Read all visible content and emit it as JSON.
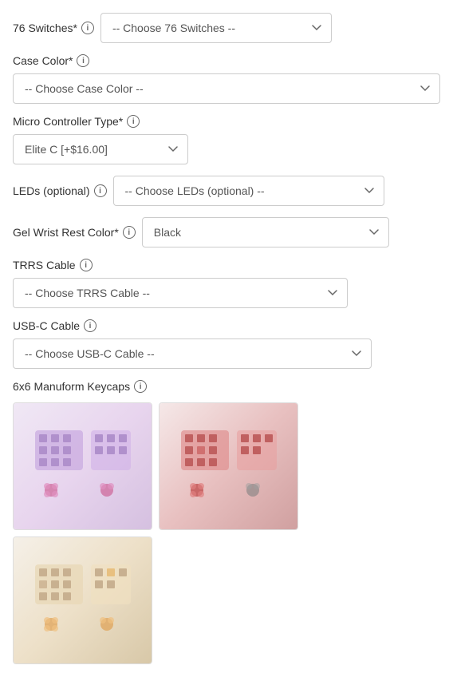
{
  "form": {
    "switches": {
      "label": "76 Switches*",
      "placeholder": "-- Choose 76 Switches --",
      "options": [
        "-- Choose 76 Switches --"
      ]
    },
    "case_color": {
      "label": "Case Color*",
      "placeholder": "-- Choose Case Color --",
      "options": [
        "-- Choose Case Color --"
      ]
    },
    "micro_controller": {
      "label": "Micro Controller Type*",
      "placeholder": "Elite C [+$16.00]",
      "selected": "Elite C [+$16.00]",
      "options": [
        "Elite C [+$16.00]"
      ]
    },
    "leds": {
      "label": "LEDs (optional)",
      "placeholder": "-- Choose LEDs (optional) --",
      "options": [
        "-- Choose LEDs (optional) --"
      ]
    },
    "gel_wrist_rest": {
      "label": "Gel Wrist Rest Color*",
      "selected": "Black",
      "options": [
        "Black"
      ]
    },
    "trrs_cable": {
      "label": "TRRS Cable",
      "placeholder": "-- Choose TRRS Cable --",
      "options": [
        "-- Choose TRRS Cable --"
      ]
    },
    "usb_c_cable": {
      "label": "USB-C Cable",
      "placeholder": "-- Choose USB-C Cable --",
      "options": [
        "-- Choose USB-C Cable --"
      ]
    },
    "keycaps": {
      "label": "6x6 Manuform Keycaps",
      "items": [
        {
          "id": "keycap-pink",
          "alt": "Pink keycap set",
          "style": "pink"
        },
        {
          "id": "keycap-red",
          "alt": "Red keycap set",
          "style": "red"
        },
        {
          "id": "keycap-cream",
          "alt": "Cream keycap set",
          "style": "cream"
        }
      ]
    }
  },
  "icons": {
    "info": "i",
    "chevron": "▾"
  }
}
